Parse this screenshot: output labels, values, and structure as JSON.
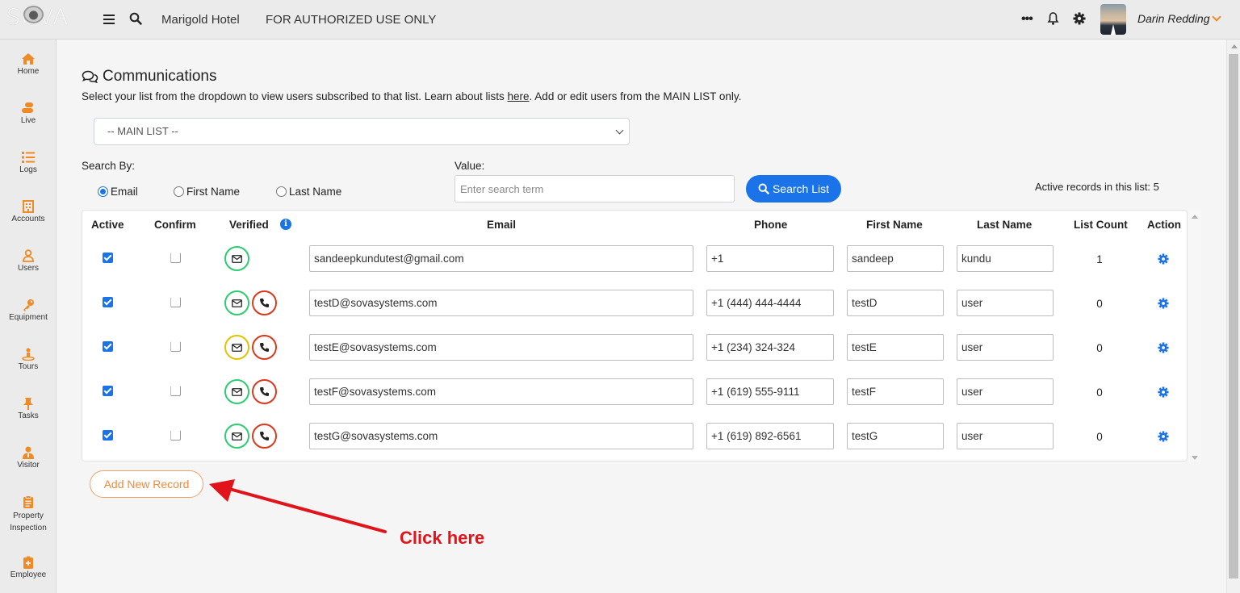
{
  "topbar": {
    "logo": "SOVA",
    "hotel": "Marigold Hotel",
    "auth_notice": "FOR AUTHORIZED USE ONLY",
    "more": "•••",
    "user_name": "Darin Redding"
  },
  "sidebar": {
    "items": [
      {
        "label": "Home",
        "icon": "home-icon"
      },
      {
        "label": "Live",
        "icon": "live-icon"
      },
      {
        "label": "Logs",
        "icon": "logs-icon"
      },
      {
        "label": "Accounts",
        "icon": "building-icon"
      },
      {
        "label": "Users",
        "icon": "user-icon"
      },
      {
        "label": "Equipment",
        "icon": "key-icon"
      },
      {
        "label": "Tours",
        "icon": "tours-icon"
      },
      {
        "label": "Tasks",
        "icon": "pin-icon"
      },
      {
        "label": "Visitor",
        "icon": "visitor-icon"
      },
      {
        "label": "Property Inspection",
        "label_line1": "Property",
        "label_line2": "Inspection",
        "icon": "clipboard-icon"
      },
      {
        "label": "Employee",
        "icon": "badge-icon"
      }
    ],
    "accent": "#f08a24"
  },
  "page": {
    "title": "Communications",
    "desc_before": "Select your list from the dropdown to view users subscribed to that list. Learn about lists ",
    "desc_link": "here",
    "desc_after": ". Add or edit users from the MAIN LIST only.",
    "list_select": "-- MAIN LIST --",
    "search_by_label": "Search By:",
    "radios": [
      "Email",
      "First Name",
      "Last Name"
    ],
    "selected_radio": "Email",
    "value_label": "Value:",
    "value_placeholder": "Enter search term",
    "search_button": "Search List",
    "active_records": "Active records in this list: 5",
    "add_button": "Add New Record",
    "annotation": "Click here"
  },
  "table": {
    "headers": {
      "active": "Active",
      "confirm": "Confirm",
      "verified": "Verified",
      "email": "Email",
      "phone": "Phone",
      "first": "First Name",
      "last": "Last Name",
      "count": "List Count",
      "action": "Action"
    },
    "rows": [
      {
        "active": true,
        "confirm": false,
        "email_status": "green",
        "phone_status": null,
        "email": "sandeepkundutest@gmail.com",
        "phone": "+1",
        "first": "sandeep",
        "last": "kundu",
        "count": "1"
      },
      {
        "active": true,
        "confirm": false,
        "email_status": "green",
        "phone_status": "red",
        "email": "testD@sovasystems.com",
        "phone": "+1 (444) 444-4444",
        "first": "testD",
        "last": "user",
        "count": "0"
      },
      {
        "active": true,
        "confirm": false,
        "email_status": "yellow",
        "phone_status": "red",
        "email": "testE@sovasystems.com",
        "phone": "+1 (234) 324-324",
        "first": "testE",
        "last": "user",
        "count": "0"
      },
      {
        "active": true,
        "confirm": false,
        "email_status": "green",
        "phone_status": "red",
        "email": "testF@sovasystems.com",
        "phone": "+1 (619) 555-9111",
        "first": "testF",
        "last": "user",
        "count": "0"
      },
      {
        "active": true,
        "confirm": false,
        "email_status": "green",
        "phone_status": "red",
        "email": "testG@sovasystems.com",
        "phone": "+1 (619) 892-6561",
        "first": "testG",
        "last": "user",
        "count": "0"
      }
    ]
  },
  "colors": {
    "primary": "#1a73e8",
    "accent": "#f08a24",
    "verified_green": "#2ecc71",
    "pending_yellow": "#e5c200",
    "unverified_red": "#d93a1c",
    "annotation_red": "#e0141a"
  }
}
